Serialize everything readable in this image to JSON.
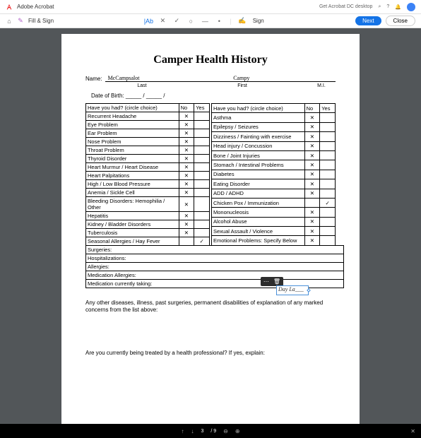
{
  "header": {
    "app": "Adobe Acrobat",
    "getDesktop": "Get Acrobat DC desktop"
  },
  "subbar": {
    "fillSign": "Fill & Sign",
    "sign": "Sign",
    "next": "Next",
    "close": "Close"
  },
  "doc": {
    "title": "Camper Health History",
    "nameLabel": "Name:",
    "lastName": "McCampsalot",
    "firstName": "Campy",
    "last": "Last",
    "first": "First",
    "mi": "M.I.",
    "dob": "Date of Birth: _____ / _____ /"
  },
  "leftHeader": {
    "q": "Have you had? (circle choice)",
    "no": "No",
    "yes": "Yes"
  },
  "rightHeader": {
    "q": "Have you had? (circle choice)",
    "no": "No",
    "yes": "Yes"
  },
  "leftRows": [
    {
      "q": "Recurrent Headache",
      "no": "✕",
      "yes": ""
    },
    {
      "q": "Eye Problem",
      "no": "✕",
      "yes": ""
    },
    {
      "q": "Ear Problem",
      "no": "✕",
      "yes": ""
    },
    {
      "q": "Nose Problem",
      "no": "✕",
      "yes": ""
    },
    {
      "q": "Throat Problem",
      "no": "✕",
      "yes": ""
    },
    {
      "q": "Thyroid Disorder",
      "no": "✕",
      "yes": ""
    },
    {
      "q": "Heart Murmur / Heart Disease",
      "no": "✕",
      "yes": ""
    },
    {
      "q": "Heart Palpitations",
      "no": "✕",
      "yes": ""
    },
    {
      "q": "High / Low Blood Pressure",
      "no": "✕",
      "yes": ""
    },
    {
      "q": "Anemia / Sickle Cell",
      "no": "✕",
      "yes": ""
    },
    {
      "q": "Bleeding Disorders: Hemophilia / Other",
      "no": "✕",
      "yes": ""
    },
    {
      "q": "Hepatitis",
      "no": "✕",
      "yes": ""
    },
    {
      "q": "Kidney / Bladder Disorders",
      "no": "✕",
      "yes": ""
    },
    {
      "q": "Tuberculosis",
      "no": "✕",
      "yes": ""
    },
    {
      "q": "Seasonal Allergies / Hay Fever",
      "no": "",
      "yes": "✓"
    }
  ],
  "rightRows": [
    {
      "q": "Asthma",
      "no": "✕",
      "yes": ""
    },
    {
      "q": "Epilepsy / Seizures",
      "no": "✕",
      "yes": ""
    },
    {
      "q": "Dizziness / Fainting with exercise",
      "no": "✕",
      "yes": ""
    },
    {
      "q": "Head injury / Concussion",
      "no": "✕",
      "yes": ""
    },
    {
      "q": "Bone / Joint Injuries",
      "no": "✕",
      "yes": ""
    },
    {
      "q": "Stomach / Intestinal Problems",
      "no": "✕",
      "yes": ""
    },
    {
      "q": "Diabetes",
      "no": "✕",
      "yes": ""
    },
    {
      "q": "Eating Disorder",
      "no": "✕",
      "yes": ""
    },
    {
      "q": "ADD / ADHD",
      "no": "✕",
      "yes": ""
    },
    {
      "q": "Chicken Pox / Immunization",
      "no": "",
      "yes": "✓"
    },
    {
      "q": "Mononucleosis",
      "no": "✕",
      "yes": ""
    },
    {
      "q": "Alcohol Abuse",
      "no": "✕",
      "yes": ""
    },
    {
      "q": "Sexual Assault / Violence",
      "no": "✕",
      "yes": ""
    },
    {
      "q": "Emotional Problems: Specify Below",
      "no": "✕",
      "yes": ""
    }
  ],
  "fullRows": [
    "Surgeries:",
    "Hospitalizations:",
    "Allergies:",
    "Medication Allergies:",
    "Medication currently taking:"
  ],
  "body1": "Any other diseases, illness, past surgeries, permanent disabilities of explanation of any marked concerns from the list above:",
  "body2": "Are you currently being treated by a health professional? If yes, explain:",
  "signature": "Day La___",
  "footer": {
    "page": "3",
    "total": "/ 9"
  }
}
